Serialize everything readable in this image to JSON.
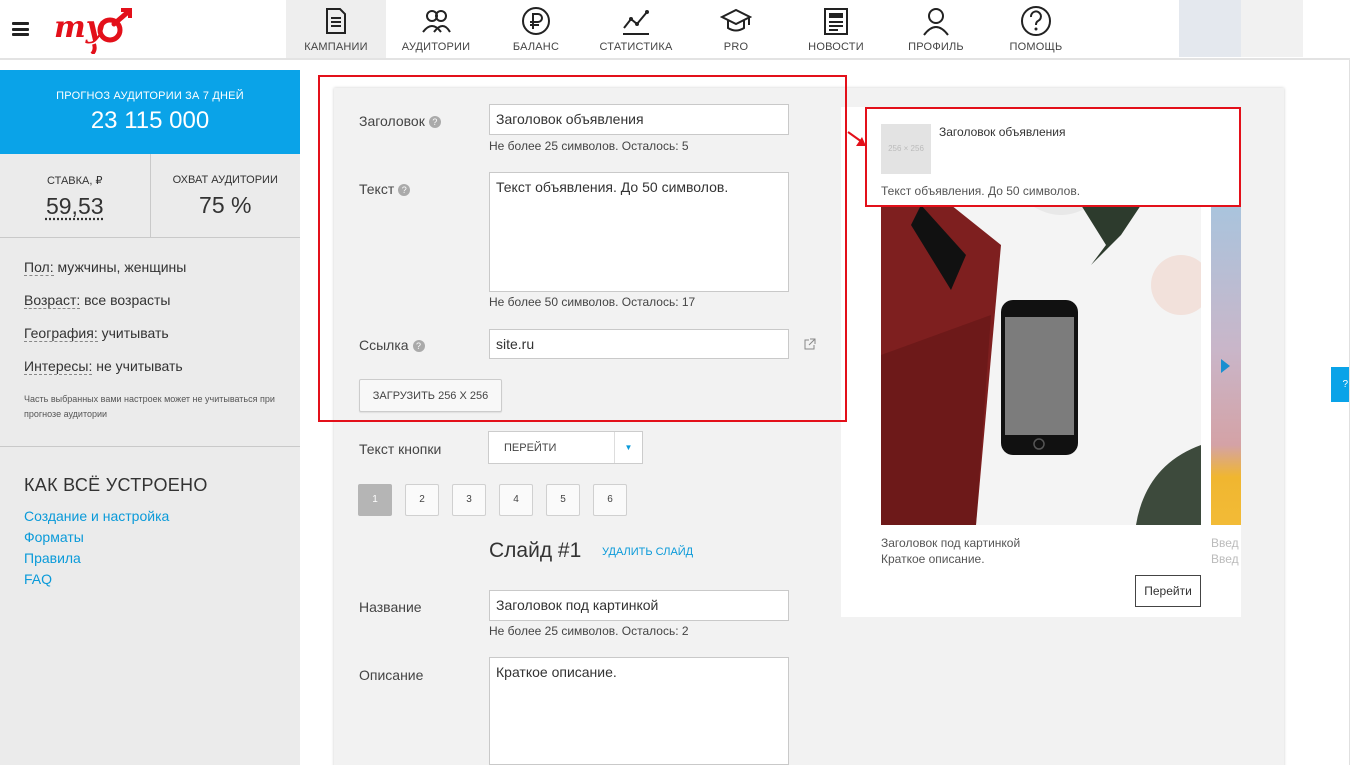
{
  "app": {
    "logo_text": "myTarget"
  },
  "nav": [
    {
      "label": "КАМПАНИИ",
      "icon": "campaigns-icon",
      "active": true
    },
    {
      "label": "АУДИТОРИИ",
      "icon": "audiences-icon"
    },
    {
      "label": "БАЛАНС",
      "icon": "ruble-icon"
    },
    {
      "label": "СТАТИСТИКА",
      "icon": "stats-icon"
    },
    {
      "label": "PRO",
      "icon": "graduation-cap-icon"
    },
    {
      "label": "НОВОСТИ",
      "icon": "news-icon"
    },
    {
      "label": "ПРОФИЛЬ",
      "icon": "profile-icon"
    },
    {
      "label": "ПОМОЩЬ",
      "icon": "help-icon"
    }
  ],
  "sidebar": {
    "forecast_title": "ПРОГНОЗ АУДИТОРИИ ЗА 7 ДНЕЙ",
    "forecast_value": "23 115 000",
    "bid_label": "СТАВКА, ₽",
    "bid_value": "59,53",
    "reach_label": "ОХВАТ АУДИТОРИИ",
    "reach_value": "75 %",
    "settings": [
      {
        "key": "Пол:",
        "value": "мужчины, женщины"
      },
      {
        "key": "Возраст:",
        "value": "все возрасты"
      },
      {
        "key": "География:",
        "value": "учитывать"
      },
      {
        "key": "Интересы:",
        "value": "не учитывать"
      }
    ],
    "note": "Часть выбранных вами настроек может не учитываться при прогнозе аудитории",
    "howto_title": "КАК ВСЁ УСТРОЕНО",
    "links": [
      "Создание и настройка",
      "Форматы",
      "Правила",
      "FAQ"
    ]
  },
  "form": {
    "title_label": "Заголовок",
    "title_value": "Заголовок объявления",
    "title_hint": "Не более  25  символов. Осталось: 5",
    "text_label": "Текст",
    "text_value": "Текст объявления. До 50 символов.",
    "text_hint": "Не более  50  символов. Осталось: 17",
    "link_label": "Ссылка",
    "link_value": "site.ru",
    "upload_label": "ЗАГРУЗИТЬ 256 X 256",
    "button_text_label": "Текст кнопки",
    "button_text_value": "ПЕРЕЙТИ",
    "slides": [
      "1",
      "2",
      "3",
      "4",
      "5",
      "6"
    ],
    "active_slide": 1,
    "slide_title": "Слайд #1",
    "delete_slide": "УДАЛИТЬ СЛАЙД",
    "name_label": "Название",
    "name_value": "Заголовок под картинкой",
    "name_hint": "Не более  25  символов. Осталось: 2",
    "desc_label": "Описание",
    "desc_value": "Краткое описание."
  },
  "preview": {
    "thumb_text": "256 × 256",
    "title": "Заголовок объявления",
    "text": "Текст объявления. До 50 символов.",
    "caption_title": "Заголовок под картинкой",
    "caption_desc": "Краткое описание.",
    "next_caption_1": "Введ",
    "next_caption_2": "Введ",
    "button": "Перейти"
  },
  "right_tab": "?",
  "colors": {
    "accent": "#0aa3e8",
    "link": "#0a9ad9",
    "logo": "#e3101a",
    "highlight": "#e3101a"
  }
}
